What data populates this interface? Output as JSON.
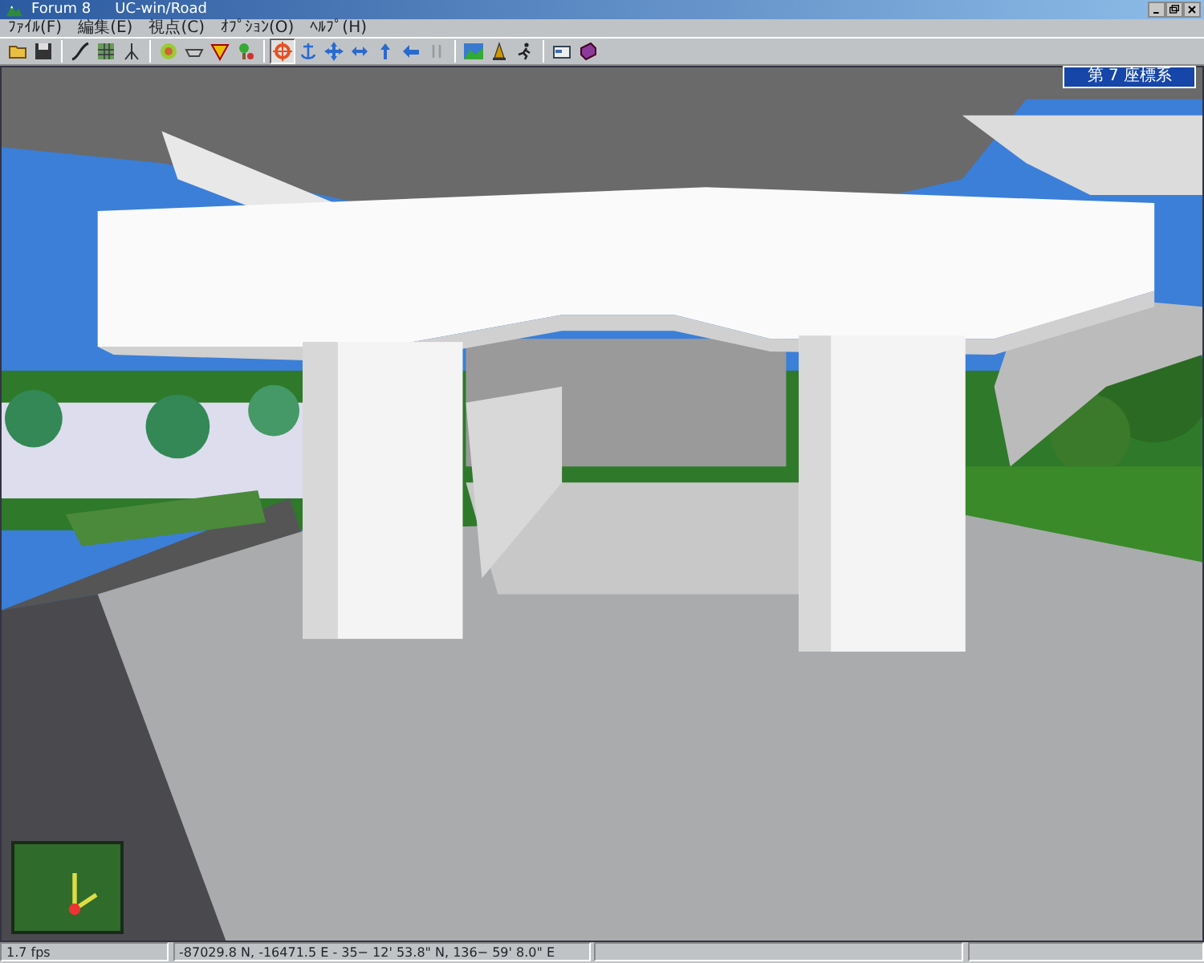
{
  "window": {
    "company": "Forum 8",
    "title": "UC-win/Road"
  },
  "menu": [
    "ﾌｧｲﾙ(F)",
    "編集(E)",
    "視点(C)",
    "ｵﾌﾟｼｮﾝ(O)",
    "ﾍﾙﾌﾟ(H)"
  ],
  "toolbar": {
    "groups": [
      [
        {
          "kind": "folder",
          "selected": false
        },
        {
          "kind": "disk",
          "selected": false
        }
      ],
      [
        {
          "kind": "curve",
          "selected": false
        },
        {
          "kind": "grid",
          "selected": false
        },
        {
          "kind": "tripod",
          "selected": false
        }
      ],
      [
        {
          "kind": "ring",
          "selected": false
        },
        {
          "kind": "bowl",
          "selected": false
        },
        {
          "kind": "shield",
          "selected": false
        },
        {
          "kind": "tree",
          "selected": false
        }
      ],
      [
        {
          "kind": "crosshair",
          "selected": true
        },
        {
          "kind": "anchor",
          "selected": false
        },
        {
          "kind": "move",
          "selected": false
        },
        {
          "kind": "flat",
          "selected": false
        },
        {
          "kind": "up",
          "selected": false
        },
        {
          "kind": "left",
          "selected": false
        },
        {
          "kind": "pause",
          "selected": false
        }
      ],
      [
        {
          "kind": "landscape",
          "selected": false
        },
        {
          "kind": "cone",
          "selected": false
        },
        {
          "kind": "runner",
          "selected": false
        }
      ],
      [
        {
          "kind": "card",
          "selected": false
        },
        {
          "kind": "book",
          "selected": false
        }
      ]
    ]
  },
  "viewport": {
    "coordinate_system": "第 7 座標系"
  },
  "status_bar": [
    "1.7 fps",
    "-87029.8 N, -16471.5 E  -  35− 12' 53.8\" N, 136− 59' 8.0\" E"
  ]
}
